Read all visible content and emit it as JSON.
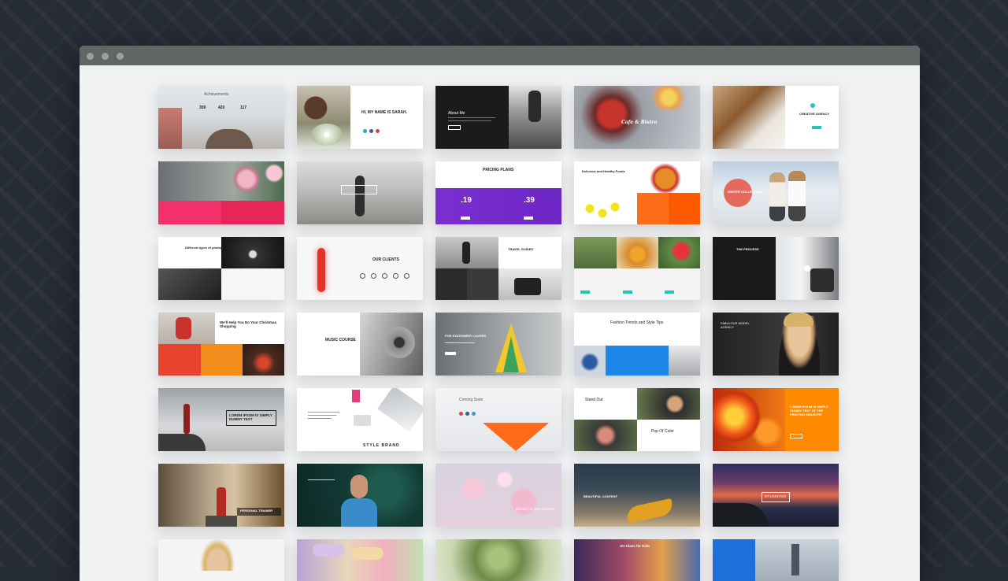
{
  "window": {
    "title_dots": [
      "close",
      "minimize",
      "maximize"
    ],
    "colors": {
      "titlebar": "#5f6665",
      "background": "#262c36"
    }
  },
  "templates": {
    "r1c1_title": "Achievements",
    "r1c1_stats": [
      "359",
      "420",
      "117"
    ],
    "r1c2_title": "HI, MY NAME IS SARAH.",
    "r1c3_title": "About Me",
    "r1c4_title": "Cafe & Bistro",
    "r1c5_title": "CREATIVE AGENCY",
    "r2c3_title": "PRICING PLANS",
    "r2c3_prices": [
      ".19",
      ".39"
    ],
    "r2c4_title": "Delicious and Healthy Foods",
    "r2c5_title": "WINTER COLLECTION",
    "r3c1_title": "Different types of photography",
    "r3c2_title": "OUR CLIENTS",
    "r3c3_title": "TRAVEL GUIDES",
    "r3c5_title": "THE PROCESS",
    "r4c1_title": "We'll Help You Do Your Christmas Shopping",
    "r4c2_title": "MUSIC COURSE",
    "r4c3_title": "FOR STATIONERY LOVERS",
    "r4c4_title": "Fashion Trends and Style Tips",
    "r4c5_title": "FABULOUS MODEL AGENCY",
    "r5c1_title": "LOREM IPSUM IS SIMPLY DUMMY TEXT",
    "r5c2_title": "STYLE BRAND",
    "r5c3_title": "Coming Soon",
    "r5c4_titles": [
      "Stand Out",
      "Pop Of Color"
    ],
    "r5c5_title": "LOREM IPSUM IS SIMPLY DUMMY TEXT OF THE PRINTING INDUSTRY",
    "r6c1_title": "PERSONAL TRAINER",
    "r6c3_title": "Beauty is everywhere",
    "r6c4_title": "BEAUTIFUL CONTENT",
    "r6c5_title": "STUNNING",
    "r7c4_title": "Art Class for Kids"
  }
}
